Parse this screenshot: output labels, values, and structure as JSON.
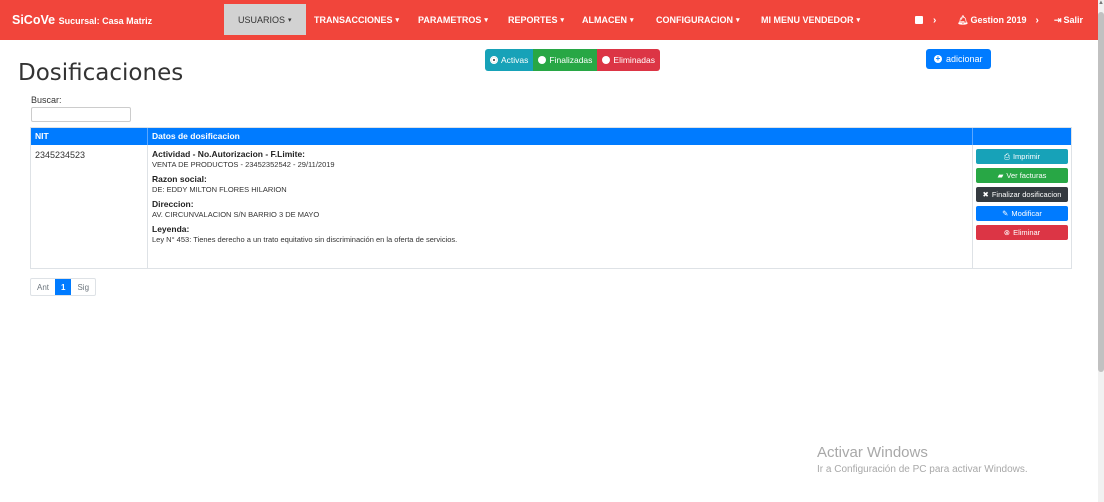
{
  "navbar": {
    "brand": "SiCoVe",
    "brand_sub": "Sucursal: Casa Matriz",
    "items": [
      {
        "label": "USUARIOS",
        "caret": "▾"
      },
      {
        "label": "TRANSACCIONES",
        "caret": "▾"
      },
      {
        "label": "PARAMETROS",
        "caret": "▾"
      },
      {
        "label": "REPORTES",
        "caret": "▾"
      },
      {
        "label": "ALMACEN",
        "caret": "▾"
      },
      {
        "label": "CONFIGURACION",
        "caret": "▾"
      },
      {
        "label": "MI MENU VENDEDOR",
        "caret": "▾"
      }
    ],
    "store_arrow": "›",
    "gestion": "Gestion 2019",
    "gestion_arrow": "›",
    "salir": "Salir"
  },
  "page": {
    "title": "Dosificaciones",
    "filters": {
      "activas": "Activas",
      "finalizadas": "Finalizadas",
      "eliminadas": "Eliminadas"
    },
    "add_label": "adicionar",
    "search_label": "Buscar:"
  },
  "table": {
    "headers": {
      "nit": "NIT",
      "datos": "Datos de dosificacion",
      "acciones": ""
    },
    "row": {
      "nit": "2345234523",
      "actividad_label": "Actividad - No.Autorizacion - F.Limite:",
      "actividad_value": "VENTA DE PRODUCTOS - 23452352542 - 29/11/2019",
      "razon_label": "Razon social:",
      "razon_value": "DE: EDDY MILTON FLORES HILARION",
      "direccion_label": "Direccion:",
      "direccion_value": "AV. CIRCUNVALACION S/N BARRIO 3 DE MAYO",
      "leyenda_label": "Leyenda:",
      "leyenda_value": "Ley N° 453: Tienes derecho a un trato equitativo sin discriminación en la oferta de servicios.",
      "actions": {
        "imprimir": "Imprimir",
        "ver_facturas": "Ver facturas",
        "finalizar": "Finalizar dosificacion",
        "modificar": "Modificar",
        "eliminar": "Eliminar"
      }
    }
  },
  "pagination": {
    "prev": "Ant",
    "current": "1",
    "next": "Sig"
  },
  "watermark": {
    "line1": "Activar Windows",
    "line2": "Ir a Configuración de PC para activar Windows."
  },
  "colors": {
    "navbar": "#f1453b",
    "primary": "#007bff",
    "teal": "#17a2b8",
    "green": "#28a745",
    "red": "#dc3545",
    "dark": "#343a40"
  }
}
